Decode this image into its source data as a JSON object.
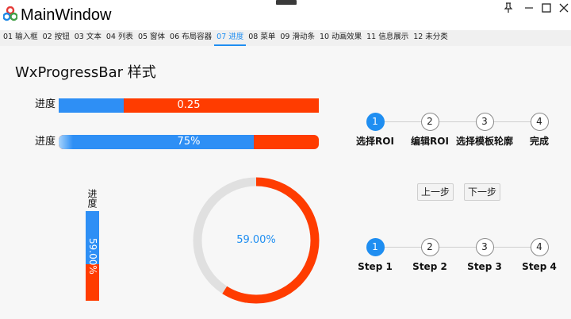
{
  "window": {
    "title": "MainWindow"
  },
  "tabs": [
    {
      "label": "01 输入框",
      "active": false
    },
    {
      "label": "02 按钮",
      "active": false
    },
    {
      "label": "03 文本",
      "active": false
    },
    {
      "label": "04 列表",
      "active": false
    },
    {
      "label": "05 窗体",
      "active": false
    },
    {
      "label": "06 布局容器",
      "active": false
    },
    {
      "label": "07 进度",
      "active": true
    },
    {
      "label": "08 菜单",
      "active": false
    },
    {
      "label": "09 滑动条",
      "active": false
    },
    {
      "label": "10 动画效果",
      "active": false
    },
    {
      "label": "11 信息展示",
      "active": false
    },
    {
      "label": "12 未分类",
      "active": false
    }
  ],
  "page": {
    "title": "WxProgressBar 样式"
  },
  "progress_bars": {
    "bar1": {
      "label": "进度",
      "value": 0.25,
      "text": "0.25"
    },
    "bar2": {
      "label": "进度",
      "value": 0.75,
      "text": "75%"
    },
    "vertical": {
      "label": "进度",
      "value": 0.59,
      "text": "59.00%"
    },
    "ring": {
      "value": 0.59,
      "text": "59.00%"
    }
  },
  "colors": {
    "accent": "#2e8ff5",
    "remaining": "#ff3c00",
    "track": "#e0e0e0"
  },
  "steps_cn": [
    {
      "number": "1",
      "label": "选择ROI",
      "active": true
    },
    {
      "number": "2",
      "label": "编辑ROI",
      "active": false
    },
    {
      "number": "3",
      "label": "选择模板轮廓",
      "active": false
    },
    {
      "number": "4",
      "label": "完成",
      "active": false
    }
  ],
  "steps_en": [
    {
      "number": "1",
      "label": "Step 1",
      "active": true
    },
    {
      "number": "2",
      "label": "Step 2",
      "active": false
    },
    {
      "number": "3",
      "label": "Step 3",
      "active": false
    },
    {
      "number": "4",
      "label": "Step 4",
      "active": false
    }
  ],
  "buttons": {
    "prev": "上一步",
    "next": "下一步"
  }
}
